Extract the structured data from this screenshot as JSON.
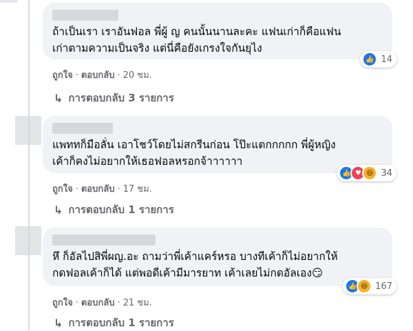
{
  "comments": [
    {
      "lines": [
        "ถ้าเป็นเรา เราอันฟอล พี่ผู้ ญ คนนั้นนานละคะ แฟนเก่าก็คือแฟน",
        "เก่าตามความเป็นจริง แต่นี่คือยังเกรงใจกันยุไง"
      ],
      "like_label": "ถูกใจ",
      "reply_label": "ตอบกลับ",
      "time": "20 ชม.",
      "reaction_count": "14",
      "reactions": [
        "like-icon"
      ],
      "replies_label": "การตอบกลับ 3 รายการ"
    },
    {
      "lines": [
        "แพททก็มือลั่น เอาโชว์โดยไม่สกรีนก่อน โป๊ะแตกกกกก พี่ผู้หญิง",
        "เค้าก็คงไม่อยากให้เธอฟอลหรอกจ้าาาาาา"
      ],
      "like_label": "ถูกใจ",
      "reply_label": "ตอบกลับ",
      "time": "17 ชม.",
      "reaction_count": "34",
      "reactions": [
        "like-icon",
        "love-icon",
        "haha-icon"
      ],
      "replies_label": "การตอบกลับ 1 รายการ"
    },
    {
      "lines": [
        "หึ ก็อัลไปสิพี่ผญ.อะ ถามว่าพี่เค้าแคร์หรอ บางทีเค้าก็ไม่อยากให้",
        "กดฟอลเค้าก็ได้ แต่พอดีเค้ามีมารยาท เค้าเลยไม่กดอัลเอง😏"
      ],
      "like_label": "ถูกใจ",
      "reply_label": "ตอบกลับ",
      "time": "21 ชม.",
      "reaction_count": "167",
      "reactions": [
        "like-icon",
        "haha-icon"
      ],
      "replies_label": "การตอบกลับ 1 รายการ"
    }
  ],
  "colors": {
    "bubble": "#f0f2f5",
    "meta_text": "#65676b",
    "like_blue": "#1877f2",
    "love_red": "#f33e58",
    "haha_yellow": "#f7b125"
  },
  "icons": {
    "reply_arrow": "↳",
    "like_glyph": "👍",
    "love_glyph": "♥",
    "haha_glyph": "😆"
  }
}
